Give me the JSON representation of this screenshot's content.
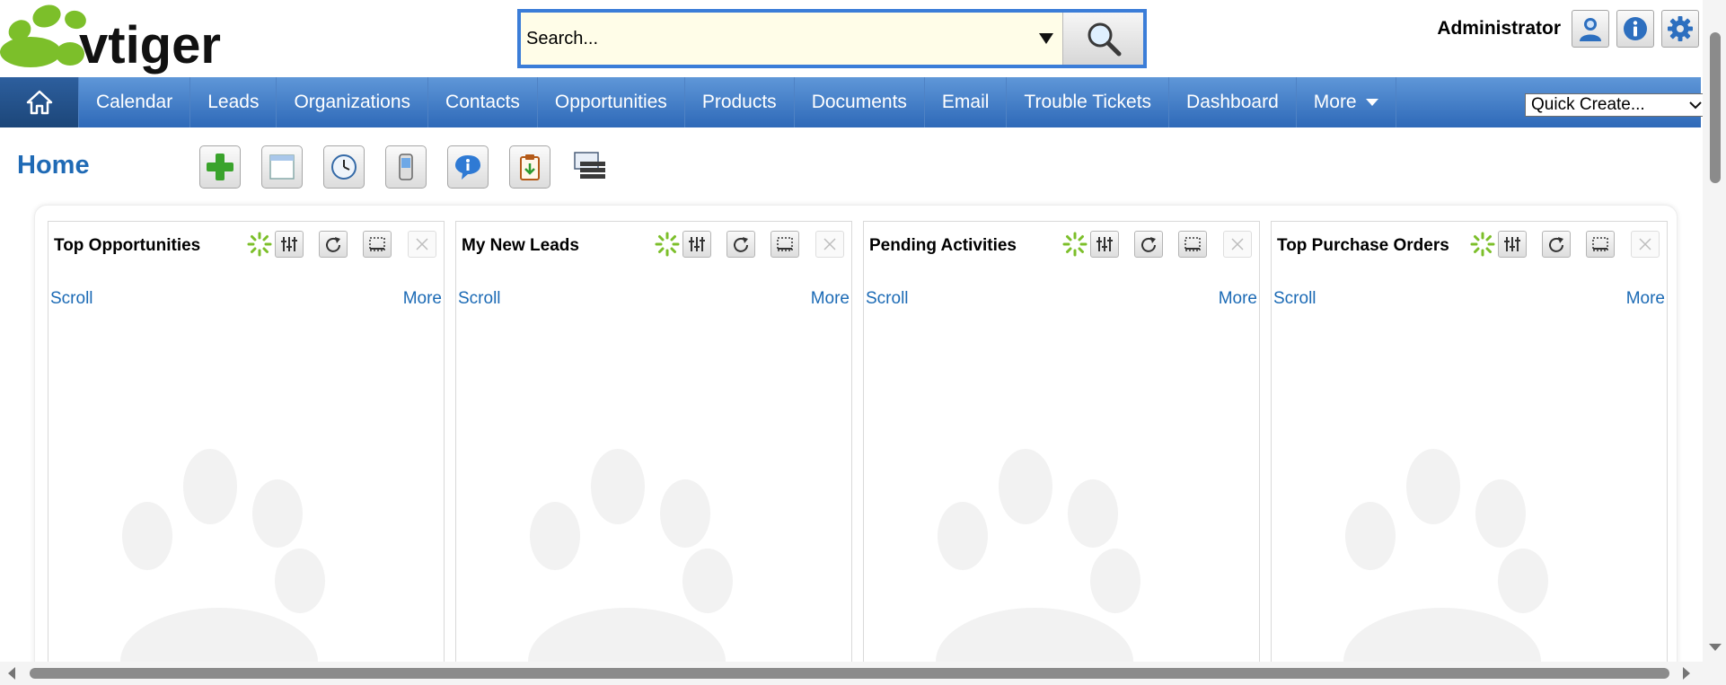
{
  "app": {
    "logo_text": "vtiger",
    "brand_color": "#1f6ab5",
    "logo_green": "#7cbf2a"
  },
  "search": {
    "placeholder": "Search...",
    "icon": "magnifier-icon"
  },
  "user": {
    "name": "Administrator",
    "icons": [
      "user-profile-icon",
      "info-icon",
      "settings-gear-icon"
    ]
  },
  "nav": {
    "home_icon": "home-icon",
    "items": [
      "Calendar",
      "Leads",
      "Organizations",
      "Contacts",
      "Opportunities",
      "Products",
      "Documents",
      "Email",
      "Trouble Tickets",
      "Dashboard"
    ],
    "more_label": "More",
    "quick_create_label": "Quick Create...",
    "bar_color": "#3f7cc8"
  },
  "page": {
    "title": "Home",
    "toolbar_icons": [
      "add-widget-icon",
      "calendar-window-icon",
      "clock-icon",
      "mobile-device-icon",
      "chat-info-icon",
      "clipboard-import-icon",
      "layout-list-icon"
    ]
  },
  "widgets": [
    {
      "title": "Top Opportunities",
      "scroll_label": "Scroll",
      "more_label": "More"
    },
    {
      "title": "My New Leads",
      "scroll_label": "Scroll",
      "more_label": "More"
    },
    {
      "title": "Pending Activities",
      "scroll_label": "Scroll",
      "more_label": "More"
    },
    {
      "title": "Top Purchase Orders",
      "scroll_label": "Scroll",
      "more_label": "More"
    }
  ],
  "widget_tool_icons": [
    "loading-spinner-icon",
    "sliders-icon",
    "refresh-icon",
    "resize-icon",
    "close-icon"
  ]
}
